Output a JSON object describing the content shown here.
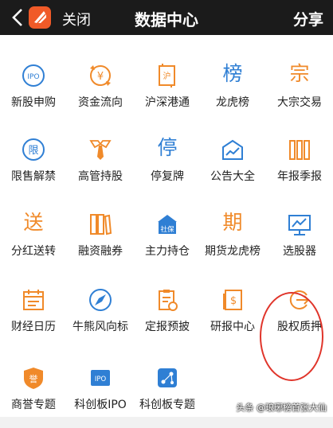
{
  "header": {
    "close_label": "关闭",
    "title": "数据中心",
    "share_label": "分享"
  },
  "colors": {
    "orange": "#f08a2a",
    "blue": "#2f7fd4",
    "topbar": "#1b1b1b",
    "circle": "#e0352b"
  },
  "items": [
    {
      "label": "新股申购",
      "icon": "ipo-icon"
    },
    {
      "label": "资金流向",
      "icon": "money-flow-icon"
    },
    {
      "label": "沪深港通",
      "icon": "shanghai-connect-icon"
    },
    {
      "label": "龙虎榜",
      "glyph": "榜",
      "icon": "ranking-icon"
    },
    {
      "label": "大宗交易",
      "glyph": "宗",
      "icon": "block-trade-icon"
    },
    {
      "label": "限售解禁",
      "icon": "restricted-shares-icon"
    },
    {
      "label": "高管持股",
      "icon": "executive-tie-icon"
    },
    {
      "label": "停复牌",
      "glyph": "停",
      "icon": "suspension-icon"
    },
    {
      "label": "公告大全",
      "icon": "announcement-icon"
    },
    {
      "label": "年报季报",
      "icon": "reports-icon"
    },
    {
      "label": "分红送转",
      "glyph": "送",
      "icon": "dividend-icon"
    },
    {
      "label": "融资融券",
      "icon": "margin-books-icon"
    },
    {
      "label": "主力持仓",
      "icon": "social-security-icon",
      "badge": "社保"
    },
    {
      "label": "期货龙虎榜",
      "glyph": "期",
      "icon": "futures-icon"
    },
    {
      "label": "选股器",
      "icon": "stock-picker-icon"
    },
    {
      "label": "财经日历",
      "icon": "calendar-icon"
    },
    {
      "label": "牛熊风向标",
      "icon": "compass-icon"
    },
    {
      "label": "定报预披",
      "icon": "clipboard-icon"
    },
    {
      "label": "研报中心",
      "icon": "research-icon"
    },
    {
      "label": "股权质押",
      "icon": "pledge-icon"
    },
    {
      "label": "商誉专题",
      "icon": "goodwill-shield-icon",
      "badge": "誉"
    },
    {
      "label": "科创板IPO",
      "icon": "star-board-ipo-icon",
      "badge": "IPO"
    },
    {
      "label": "科创板专题",
      "icon": "star-board-topic-icon"
    }
  ],
  "watermark": "头条 @琅琊榜首张大仙"
}
